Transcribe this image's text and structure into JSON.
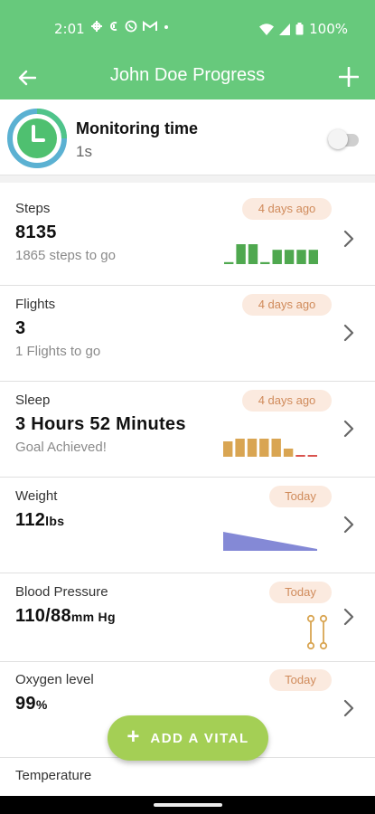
{
  "status_bar": {
    "time": "2:01",
    "battery": "100%",
    "icons": [
      "grid-icon",
      "at-icon",
      "whatsapp-icon",
      "mail-icon",
      "dot-icon",
      "wifi-icon",
      "signal-icon",
      "battery-icon"
    ]
  },
  "app_bar": {
    "title": "John Doe Progress"
  },
  "monitor": {
    "title": "Monitoring time",
    "value": "1s",
    "toggle_on": false
  },
  "colors": {
    "primary": "#67c97c",
    "fab": "#a4cf55",
    "badge_bg": "#fbeadf",
    "badge_text": "#d08b5b",
    "steps_bar": "#4fa84f",
    "sleep_bar": "#d9a552",
    "sleep_low": "#d9534f",
    "weight_area": "#6e74cf",
    "bp_line": "#d9a552"
  },
  "vitals": [
    {
      "label": "Steps",
      "value": "8135",
      "unit": "",
      "sub": "1865 steps to go",
      "badge": "4 days ago",
      "chart": {
        "type": "bar",
        "values": [
          0.1,
          1.0,
          1.0,
          0.1,
          0.72,
          0.72,
          0.72,
          0.72
        ],
        "color": "steps"
      }
    },
    {
      "label": "Flights",
      "value": "3",
      "unit": "",
      "sub": "1 Flights to go",
      "badge": "4 days ago"
    },
    {
      "label": "Sleep",
      "value": "3 Hours 52 Minutes",
      "unit": "",
      "sub": "Goal Achieved!",
      "badge": "4 days ago",
      "chart": {
        "type": "bar",
        "values": [
          0.85,
          1.0,
          1.0,
          1.0,
          1.0,
          0.45,
          0.1,
          0.1
        ],
        "color": "sleep"
      }
    },
    {
      "label": "Weight",
      "value": "112",
      "unit": "lbs",
      "sub": "",
      "badge": "Today"
    },
    {
      "label": "Blood Pressure",
      "value": "110/88",
      "unit": "mm Hg",
      "sub": "",
      "badge": "Today"
    },
    {
      "label": "Oxygen level",
      "value": "99",
      "unit": "%",
      "sub": "",
      "badge": "Today"
    },
    {
      "label": "Temperature",
      "value": "",
      "unit": "",
      "sub": "",
      "badge": ""
    }
  ],
  "fab": {
    "label": "ADD A VITAL"
  }
}
